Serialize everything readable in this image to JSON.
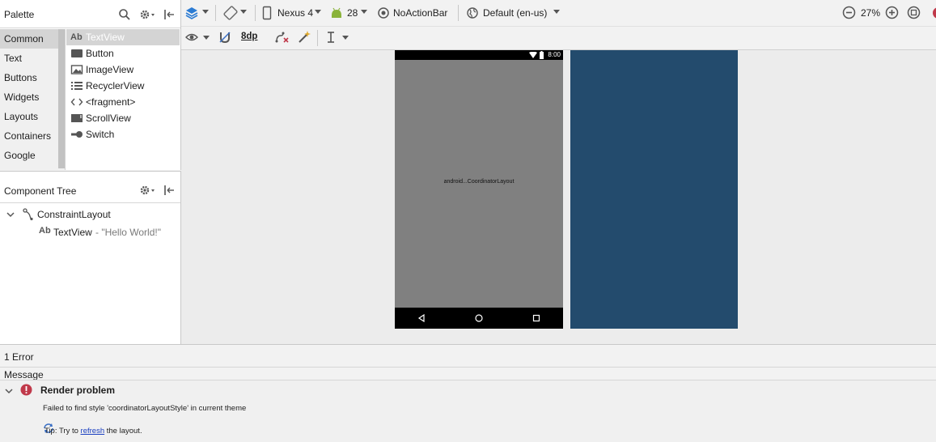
{
  "palette": {
    "title": "Palette",
    "categories": [
      "Common",
      "Text",
      "Buttons",
      "Widgets",
      "Layouts",
      "Containers",
      "Google"
    ],
    "selected_category": "Common",
    "widgets": [
      {
        "label": "TextView",
        "icon": "ab-icon",
        "selected": true
      },
      {
        "label": "Button",
        "icon": "button-icon"
      },
      {
        "label": "ImageView",
        "icon": "image-icon"
      },
      {
        "label": "RecyclerView",
        "icon": "list-icon"
      },
      {
        "label": "<fragment>",
        "icon": "code-icon"
      },
      {
        "label": "ScrollView",
        "icon": "scrollview-icon"
      },
      {
        "label": "Switch",
        "icon": "switch-icon"
      }
    ]
  },
  "component_tree": {
    "title": "Component Tree",
    "root": "ConstraintLayout",
    "child_icon_text": "Ab",
    "child": "TextView",
    "child_detail": "- \"Hello World!\""
  },
  "toolbar": {
    "device": "Nexus 4",
    "api_level": "28",
    "theme": "NoActionBar",
    "locale": "Default (en-us)",
    "zoom": "27%",
    "margin": "8dp"
  },
  "phone": {
    "status_time": "8:00",
    "center_text": "android...CoordinatorLayout"
  },
  "errors": {
    "count_label": "1 Error",
    "column_header": "Message",
    "title": "Render problem",
    "detail": "Failed to find style 'coordinatorLayoutStyle' in current theme",
    "tip_prefix": "Tip: Try to ",
    "tip_link": "refresh",
    "tip_suffix": " the layout."
  },
  "colors": {
    "blueprint": "#234b6d",
    "design_surface": "#808080",
    "error": "#c0394a",
    "link": "#1a3fc0"
  }
}
